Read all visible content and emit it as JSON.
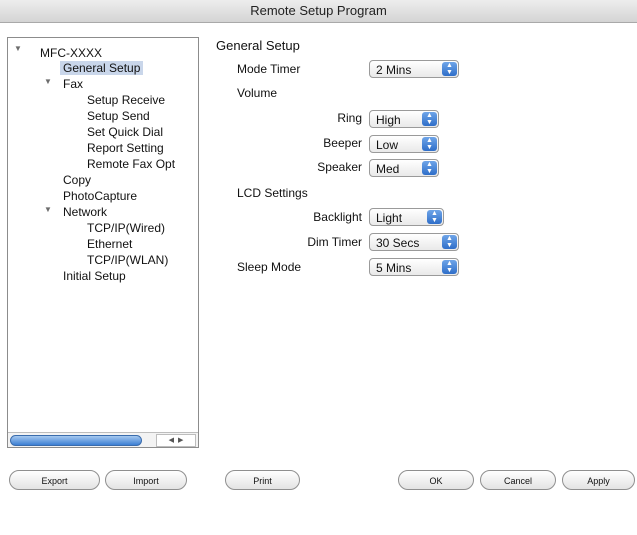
{
  "window": {
    "title": "Remote Setup Program"
  },
  "tree": {
    "items": [
      {
        "label": "MFC-XXXX"
      },
      {
        "label": "General Setup"
      },
      {
        "label": "Fax"
      },
      {
        "label": "Setup Receive"
      },
      {
        "label": "Setup Send"
      },
      {
        "label": "Set Quick Dial"
      },
      {
        "label": "Report Setting"
      },
      {
        "label": "Remote Fax Opt"
      },
      {
        "label": "Copy"
      },
      {
        "label": "PhotoCapture"
      },
      {
        "label": "Network"
      },
      {
        "label": "TCP/IP(Wired)"
      },
      {
        "label": "Ethernet"
      },
      {
        "label": "TCP/IP(WLAN)"
      },
      {
        "label": "Initial Setup"
      }
    ],
    "selected": "General Setup"
  },
  "panel": {
    "title": "General Setup",
    "mode_timer": {
      "label": "Mode Timer",
      "value": "2 Mins"
    },
    "volume": {
      "label": "Volume",
      "ring": {
        "label": "Ring",
        "value": "High"
      },
      "beeper": {
        "label": "Beeper",
        "value": "Low"
      },
      "speaker": {
        "label": "Speaker",
        "value": "Med"
      }
    },
    "lcd": {
      "label": "LCD Settings",
      "backlight": {
        "label": "Backlight",
        "value": "Light"
      },
      "dim_timer": {
        "label": "Dim Timer",
        "value": "30 Secs"
      }
    },
    "sleep_mode": {
      "label": "Sleep Mode",
      "value": "5 Mins"
    }
  },
  "buttons": {
    "export": "Export",
    "import": "Import",
    "print": "Print",
    "ok": "OK",
    "cancel": "Cancel",
    "apply": "Apply"
  }
}
